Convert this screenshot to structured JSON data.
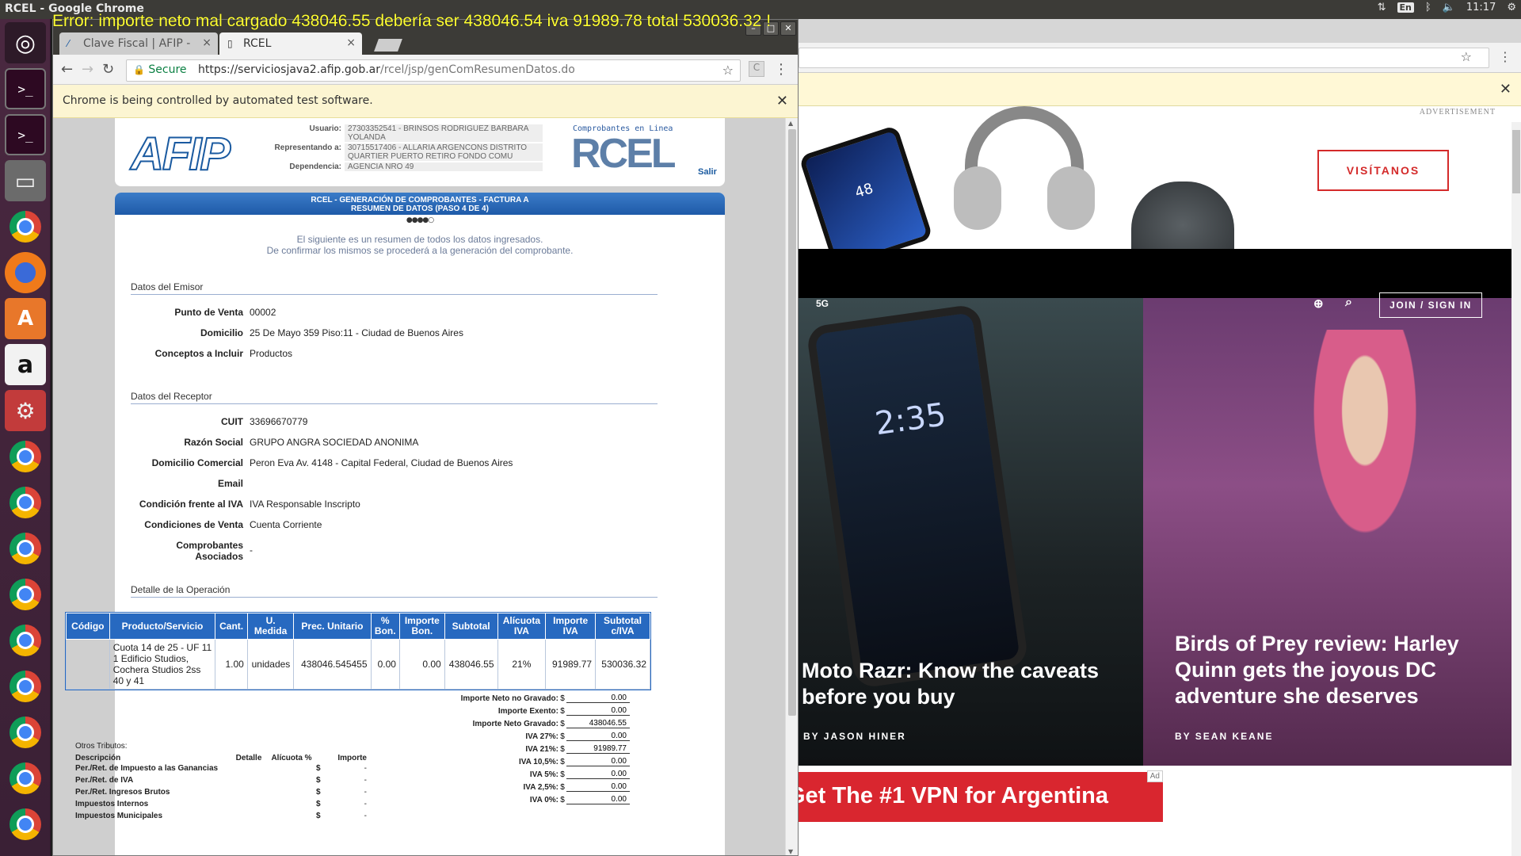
{
  "os": {
    "window_title": "RCEL - Google Chrome",
    "time": "11:17",
    "lang": "En"
  },
  "error_banner": "Error: importe neto mal cargado 438046.55 debería ser 438046.54 iva 91989.78 total 530036.32 !",
  "tabs": [
    {
      "label": "Clave Fiscal | AFIP -",
      "icon": "afip-favicon-icon"
    },
    {
      "label": "RCEL",
      "icon": "page-icon"
    }
  ],
  "url": {
    "secure_label": "Secure",
    "host": "https://serviciosjava2.afip.gob.ar",
    "path": "/rcel/jsp/genComResumenDatos.do"
  },
  "infobar": "Chrome is being controlled by automated test software.",
  "header": {
    "logo": "AFIP",
    "usuario_label": "Usuario:",
    "usuario": "27303352541 - BRINSOS RODRIGUEZ BARBARA YOLANDA",
    "representando_label": "Representando a:",
    "representando": "30715517406 - ALLARIA ARGENCONS DISTRITO QUARTIER PUERTO RETIRO FONDO COMU",
    "dependencia_label": "Dependencia:",
    "dependencia": "AGENCIA NRO 49",
    "rcel_caption": "Comprobantes en Linea",
    "rcel_logo": "RCEL",
    "salir": "Salir"
  },
  "title_line1": "RCEL - GENERACIÓN DE COMPROBANTES - FACTURA A",
  "title_line2": "RESUMEN DE DATOS (PASO 4 DE 4)",
  "steps": "●●●●○",
  "intro_1": "El siguiente es un resumen de todos los datos ingresados.",
  "intro_2": "De confirmar los mismos se procederá a la generación del comprobante.",
  "emisor": {
    "section": "Datos del Emisor",
    "fields": [
      {
        "k": "Punto de Venta",
        "v": "00002"
      },
      {
        "k": "Domicilio",
        "v": "25 De Mayo 359 Piso:11 - Ciudad de Buenos Aires"
      },
      {
        "k": "Conceptos a Incluir",
        "v": "Productos"
      }
    ]
  },
  "receptor": {
    "section": "Datos del Receptor",
    "fields": [
      {
        "k": "CUIT",
        "v": "33696670779"
      },
      {
        "k": "Razón Social",
        "v": "GRUPO ANGRA SOCIEDAD ANONIMA"
      },
      {
        "k": "Domicilio Comercial",
        "v": "Peron Eva Av. 4148 - Capital Federal, Ciudad de Buenos Aires"
      },
      {
        "k": "Email",
        "v": ""
      },
      {
        "k": "Condición frente al IVA",
        "v": "IVA Responsable Inscripto"
      },
      {
        "k": "Condiciones de Venta",
        "v": "Cuenta Corriente"
      },
      {
        "k": "Comprobantes Asociados",
        "v": "-"
      }
    ]
  },
  "detalle": {
    "section": "Detalle de la Operación",
    "headers": [
      "Código",
      "Producto/Servicio",
      "Cant.",
      "U. Medida",
      "Prec. Unitario",
      "% Bon.",
      "Importe Bon.",
      "Subtotal",
      "Alícuota IVA",
      "Importe IVA",
      "Subtotal c/IVA"
    ],
    "row": [
      "",
      "Cuota 14 de 25 - UF 11 1 Edificio Studios, Cochera Studios 2ss 40 y 41",
      "1.00",
      "unidades",
      "438046.545455",
      "0.00",
      "0.00",
      "438046.55",
      "21%",
      "91989.77",
      "530036.32"
    ]
  },
  "totales": [
    {
      "k": "Importe Neto no Gravado:",
      "v": "0.00"
    },
    {
      "k": "Importe Exento:",
      "v": "0.00"
    },
    {
      "k": "Importe Neto Gravado:",
      "v": "438046.55"
    },
    {
      "k": "IVA 27%:",
      "v": "0.00"
    },
    {
      "k": "IVA 21%:",
      "v": "91989.77"
    },
    {
      "k": "IVA 10,5%:",
      "v": "0.00"
    },
    {
      "k": "IVA 5%:",
      "v": "0.00"
    },
    {
      "k": "IVA 2,5%:",
      "v": "0.00"
    },
    {
      "k": "IVA 0%:",
      "v": "0.00"
    }
  ],
  "currency": "$",
  "otros": {
    "title": "Otros Tributos:",
    "headers": [
      "Descripción",
      "Detalle",
      "Alícuota %",
      "Importe"
    ],
    "rows": [
      {
        "d": "Per./Ret. de Impuesto a las Ganancias",
        "v": "-"
      },
      {
        "d": "Per./Ret. de IVA",
        "v": "-"
      },
      {
        "d": "Per./Ret. Ingresos Brutos",
        "v": "-"
      },
      {
        "d": "Impuestos Internos",
        "v": "-"
      },
      {
        "d": "Impuestos Municipales",
        "v": "-"
      }
    ]
  },
  "background_page": {
    "advertisement": "ADVERTISEMENT",
    "phone_screen": "48",
    "ad_button": "VISÍTANOS",
    "nav_5g": "5G",
    "join": "JOIN / SIGN IN",
    "razr_time": "2:35",
    "headline_1": "Moto Razr: Know the caveats before you buy",
    "byline_1": "BY JASON HINER",
    "headline_2": "Birds of Prey review: Harley Quinn gets the joyous DC adventure she deserves",
    "byline_2": "BY SEAN KEANE",
    "ad2": "Get The #1 VPN for Argentina",
    "ad_tag": "Ad"
  }
}
